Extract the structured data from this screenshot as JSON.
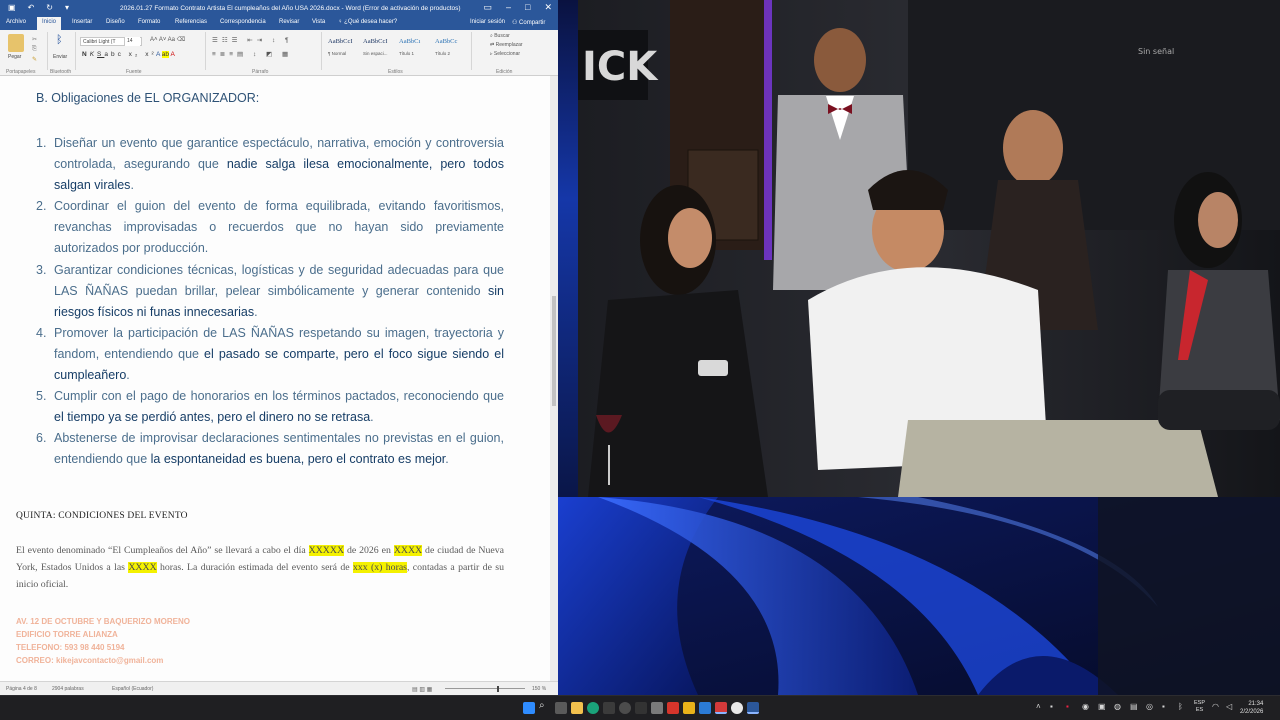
{
  "word": {
    "window_title": "2026.01.27 Formato Contrato Artista El cumpleaños del Año USA 2026.docx - Word (Error de activación de productos)",
    "tabs": [
      "Archivo",
      "Inicio",
      "Insertar",
      "Diseño",
      "Formato",
      "Referencias",
      "Correspondencia",
      "Revisar",
      "Vista"
    ],
    "tell_me": "¿Qué desea hacer?",
    "sign_in": "Iniciar sesión",
    "share": "Compartir",
    "ribbon": {
      "paste": "Pegar",
      "bluetooth": "Enviar",
      "font_name": "Calibri Light (T",
      "font_size": "14",
      "groups": [
        "Portapapeles",
        "Bluetooth",
        "Fuente",
        "Párrafo",
        "Estilos",
        "Edición"
      ],
      "styles": [
        {
          "preview": "AaBbCcI",
          "name": "¶ Normal"
        },
        {
          "preview": "AaBbCcI",
          "name": "Sin espaci..."
        },
        {
          "preview": "AaBbCı",
          "name": "Título 1"
        },
        {
          "preview": "AaBbCc",
          "name": "Título 2"
        }
      ],
      "editing": [
        "Buscar",
        "Reemplazar",
        "Seleccionar"
      ]
    },
    "document": {
      "heading": "B.   Obligaciones de EL ORGANIZADOR:",
      "obligations": [
        {
          "num": "1.",
          "text": "Diseñar un evento que garantice espectáculo, narrativa, emoción y controversia controlada, asegurando que ",
          "bold": "nadie salga ilesa emocionalmente, pero todos salgan virales",
          "after": "."
        },
        {
          "num": "2.",
          "text": "Coordinar el guion del evento de forma equilibrada, evitando favoritismos, revanchas improvisadas o recuerdos que no hayan sido previamente autorizados por producción.",
          "bold": "",
          "after": ""
        },
        {
          "num": "3.",
          "text": "Garantizar condiciones técnicas, logísticas y de seguridad adecuadas para que LAS ÑAÑAS puedan brillar, pelear simbólicamente y generar contenido ",
          "bold": "sin riesgos físicos ni funas innecesarias",
          "after": "."
        },
        {
          "num": "4.",
          "text": "Promover la participación de LAS ÑAÑAS respetando su imagen, trayectoria y fandom, entendiendo que ",
          "bold": "el pasado se comparte, pero el foco sigue siendo el cumpleañero",
          "after": "."
        },
        {
          "num": "5.",
          "text": "Cumplir con el pago de honorarios en los términos pactados, reconociendo que ",
          "bold": "el tiempo ya se perdió antes, pero el dinero no se retrasa",
          "after": "."
        },
        {
          "num": "6.",
          "text": "Abstenerse de improvisar declaraciones sentimentales no previstas en el guion, entendiendo que ",
          "bold": "la espontaneidad es buena, pero el contrato es mejor",
          "after": "."
        }
      ],
      "quinta_title": "QUINTA: CONDICIONES DEL EVENTO",
      "para": {
        "p1": "El evento denominado “El Cumpleaños del Año” se llevará a cabo el día ",
        "h1": "XXXXX",
        "p2": " de 2026 en ",
        "h2": "XXXX",
        "p3": " de ciudad de Nueva York, Estados Unidos a las ",
        "h3": "XXXX",
        "p4": " horas. La duración estimada del evento será de ",
        "h4": "xxx (x) horas",
        "p5": ", contadas a partir de su inicio oficial."
      },
      "address": [
        "AV. 12 DE OCTUBRE Y BAQUERIZO MORENO",
        "EDIFICIO TORRE ALIANZA",
        "TELEFONO: 593 98 440 5194",
        "CORREO: kikejavcontacto@gmail.com"
      ]
    },
    "status": {
      "page": "Página 4 de 8",
      "words": "2904 palabras",
      "language": "Español (Ecuador)",
      "zoom": "150 %"
    }
  },
  "taskbar": {
    "language": "ESP",
    "region": "ES",
    "time": "21:34",
    "date": "2/2/2026"
  },
  "colors": {
    "word_blue": "#2b579a",
    "doc_text": "#4b6e8c",
    "doc_bold": "#163d66",
    "highlight": "#f4f100",
    "address": "#f0b39a"
  }
}
